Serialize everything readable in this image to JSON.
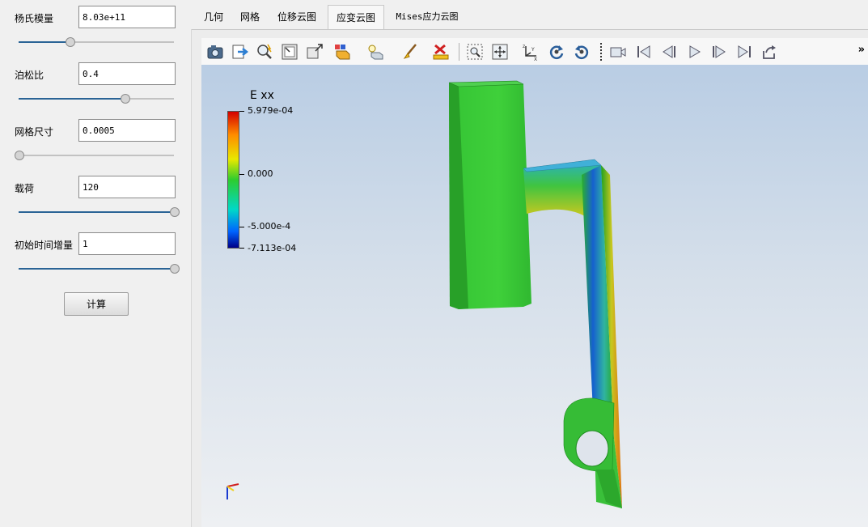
{
  "params": [
    {
      "label": "杨氏模量",
      "value": "8.03e+11",
      "slider_fraction": 0.33
    },
    {
      "label": "泊松比",
      "value": "0.4",
      "slider_fraction": 0.68
    },
    {
      "label": "网格尺寸",
      "value": "0.0005",
      "slider_fraction": 0.0
    },
    {
      "label": "载荷",
      "value": "120",
      "slider_fraction": 1.0
    },
    {
      "label": "初始时间增量",
      "value": "1",
      "slider_fraction": 1.0
    }
  ],
  "calc_button": "计算",
  "tabs": [
    {
      "label": "几何",
      "active": false
    },
    {
      "label": "网格",
      "active": false
    },
    {
      "label": "位移云图",
      "active": false
    },
    {
      "label": "应变云图",
      "active": true
    },
    {
      "label": "Mises应力云图",
      "active": false
    }
  ],
  "toolbar": {
    "icons": [
      "camera-icon",
      "export-icon",
      "zoom-interactive-icon",
      "reset-camera-icon",
      "zoom-to-box-icon",
      "representation-icon",
      "light-icon",
      "color-brush-icon",
      "delete-icon",
      "zoom-to-data-icon",
      "center-icon",
      "axes-orientation-icon",
      "rotate-cw-icon",
      "rotate-ccw-icon",
      "video-camera-icon",
      "first-frame-icon",
      "previous-frame-icon",
      "play-icon",
      "next-frame-icon",
      "last-frame-icon",
      "loop-icon"
    ],
    "more": "»"
  },
  "colorbar": {
    "title": "E xx",
    "max_label": "5.979e-04",
    "mid_label": "0.000",
    "neg_label": "-5.000e-4",
    "min_label": "-7.113e-04",
    "colors": [
      "#d40000",
      "#ff8c00",
      "#e8e800",
      "#2ecc2e",
      "#00d8c8",
      "#0064ff",
      "#000088"
    ]
  },
  "colors": {
    "model_green": "#2ec42e",
    "background_top": "#b9cde4",
    "background_bottom": "#eef0f3"
  }
}
